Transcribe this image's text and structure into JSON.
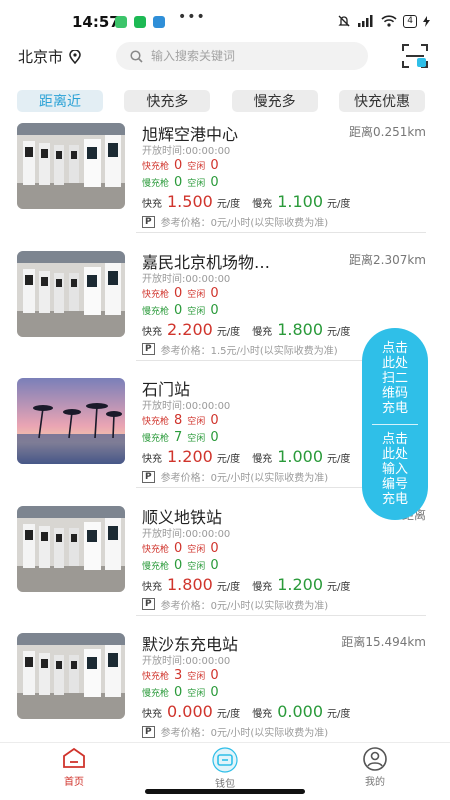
{
  "status": {
    "time": "14:57",
    "dots": "•••",
    "battery": "4"
  },
  "header": {
    "city": "北京市",
    "search_placeholder": "输入搜索关键词"
  },
  "tabs": [
    {
      "label": "距离近",
      "active": true
    },
    {
      "label": "快充多",
      "active": false
    },
    {
      "label": "慢充多",
      "active": false
    },
    {
      "label": "快充优惠",
      "active": false
    }
  ],
  "labels": {
    "open_prefix": "开放时间:",
    "fast_gun": "快充枪",
    "slow_gun": "慢充枪",
    "idle": "空闲",
    "fast": "快充",
    "slow": "慢充",
    "unit": "元/度",
    "park_badge": "P",
    "ref_price": "参考价格："
  },
  "stations": [
    {
      "name": "旭辉空港中心",
      "distance": "距离0.251km",
      "open_time": "00:00:00",
      "fast_total": "0",
      "fast_idle": "0",
      "slow_total": "0",
      "slow_idle": "0",
      "fast_price": "1.500",
      "slow_price": "1.100",
      "parking": "0元/小时(以实际收费为准)",
      "image": "chargers"
    },
    {
      "name": "嘉民北京机场物…",
      "distance": "距离2.307km",
      "open_time": "00:00:00",
      "fast_total": "0",
      "fast_idle": "0",
      "slow_total": "0",
      "slow_idle": "0",
      "fast_price": "2.200",
      "slow_price": "1.800",
      "parking": "1.5元/小时(以实际收费为准)",
      "image": "chargers"
    },
    {
      "name": "石门站",
      "distance": "距",
      "open_time": "00:00:00",
      "fast_total": "8",
      "fast_idle": "0",
      "slow_total": "7",
      "slow_idle": "0",
      "fast_price": "1.200",
      "slow_price": "1.000",
      "parking": "0元/小时(以实际收费为准)",
      "image": "sunset"
    },
    {
      "name": "顺义地铁站",
      "distance": "距离",
      "open_time": "00:00:00",
      "fast_total": "0",
      "fast_idle": "0",
      "slow_total": "0",
      "slow_idle": "0",
      "fast_price": "1.800",
      "slow_price": "1.200",
      "parking": "0元/小时(以实际收费为准)",
      "image": "chargers"
    },
    {
      "name": "默沙东充电站",
      "distance": "距离15.494km",
      "open_time": "00:00:00",
      "fast_total": "3",
      "fast_idle": "0",
      "slow_total": "0",
      "slow_idle": "0",
      "fast_price": "0.000",
      "slow_price": "0.000",
      "parking": "0元/小时(以实际收费为准)",
      "image": "chargers"
    }
  ],
  "float_button": {
    "scan_lines": [
      "点击",
      "此处",
      "扫二",
      "维码",
      "充电"
    ],
    "input_lines": [
      "点击",
      "此处",
      "输入",
      "编号",
      "充电"
    ]
  },
  "nav": [
    {
      "label": "首页",
      "icon": "home-icon",
      "active": true
    },
    {
      "label": "钱包",
      "icon": "wallet-icon",
      "active": false
    },
    {
      "label": "我的",
      "icon": "profile-icon",
      "active": false
    }
  ],
  "colors": {
    "accent": "#2ba2d6",
    "fast_red": "#d0342c",
    "slow_green": "#2a9a3a",
    "float_blue": "#2fbfe8"
  }
}
